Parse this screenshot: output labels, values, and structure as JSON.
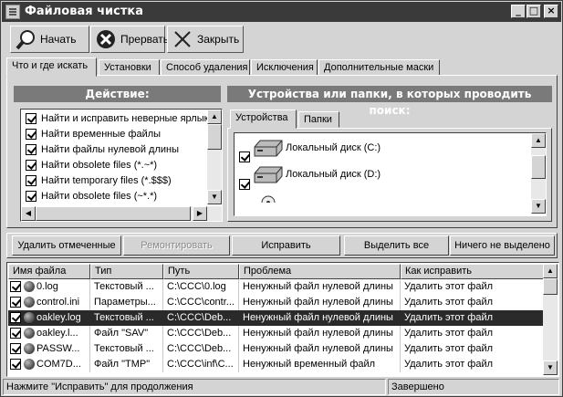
{
  "window": {
    "title": "Файловая чистка",
    "controls": [
      "_",
      "□",
      "×"
    ]
  },
  "toolbar": {
    "start": "Начать",
    "stop": "Прервать",
    "close": "Закрыть"
  },
  "tabs": [
    "Что и где искать",
    "Установки",
    "Способ удаления",
    "Исключения",
    "Дополнительные маски"
  ],
  "actions": {
    "header": "Действие:",
    "items": [
      "Найти и исправить неверные ярлык",
      "Найти временные файлы",
      "Найти файлы нулевой длины",
      "Найти obsolete files (*.~*)",
      "Найти temporary files (*.$$$)",
      "Найти obsolete files (~*.*)"
    ]
  },
  "devices": {
    "header": "Устройства или папки, в которых проводить поиск:",
    "tabs": [
      "Устройства",
      "Папки"
    ],
    "items": [
      "Локальный диск (C:)",
      "Локальный диск (D:)"
    ]
  },
  "buttons": {
    "delete_marked": "Удалить отмеченные",
    "repair": "Ремонтировать",
    "fix": "Исправить",
    "select_all": "Выделить все",
    "nothing_selected": "Ничего не выделено"
  },
  "table": {
    "columns": [
      "Имя файла",
      "Тип",
      "Путь",
      "Проблема",
      "Как исправить"
    ],
    "rows": [
      {
        "name": "0.log",
        "type": "Текстовый ...",
        "path": "C:\\CCC\\0.log",
        "problem": "Ненужный файл нулевой длины",
        "fix": "Удалить этот файл"
      },
      {
        "name": "control.ini",
        "type": "Параметры...",
        "path": "C:\\CCC\\contr...",
        "problem": "Ненужный файл нулевой длины",
        "fix": "Удалить этот файл"
      },
      {
        "name": "oakley.log",
        "type": "Текстовый ...",
        "path": "C:\\CCC\\Deb...",
        "problem": "Ненужный файл нулевой длины",
        "fix": "Удалить этот файл"
      },
      {
        "name": "oakley.l...",
        "type": "Файл \"SAV\"",
        "path": "C:\\CCC\\Deb...",
        "problem": "Ненужный файл нулевой длины",
        "fix": "Удалить этот файл"
      },
      {
        "name": "PASSW...",
        "type": "Текстовый ...",
        "path": "C:\\CCC\\Deb...",
        "problem": "Ненужный файл нулевой длины",
        "fix": "Удалить этот файл"
      },
      {
        "name": "COM7D...",
        "type": "Файл \"TMP\"",
        "path": "C:\\CCC\\inf\\C...",
        "problem": "Ненужный временный файл",
        "fix": "Удалить этот файл"
      }
    ]
  },
  "status": {
    "left": "Нажмите \"Исправить\" для продолжения",
    "right": "Завершено"
  }
}
